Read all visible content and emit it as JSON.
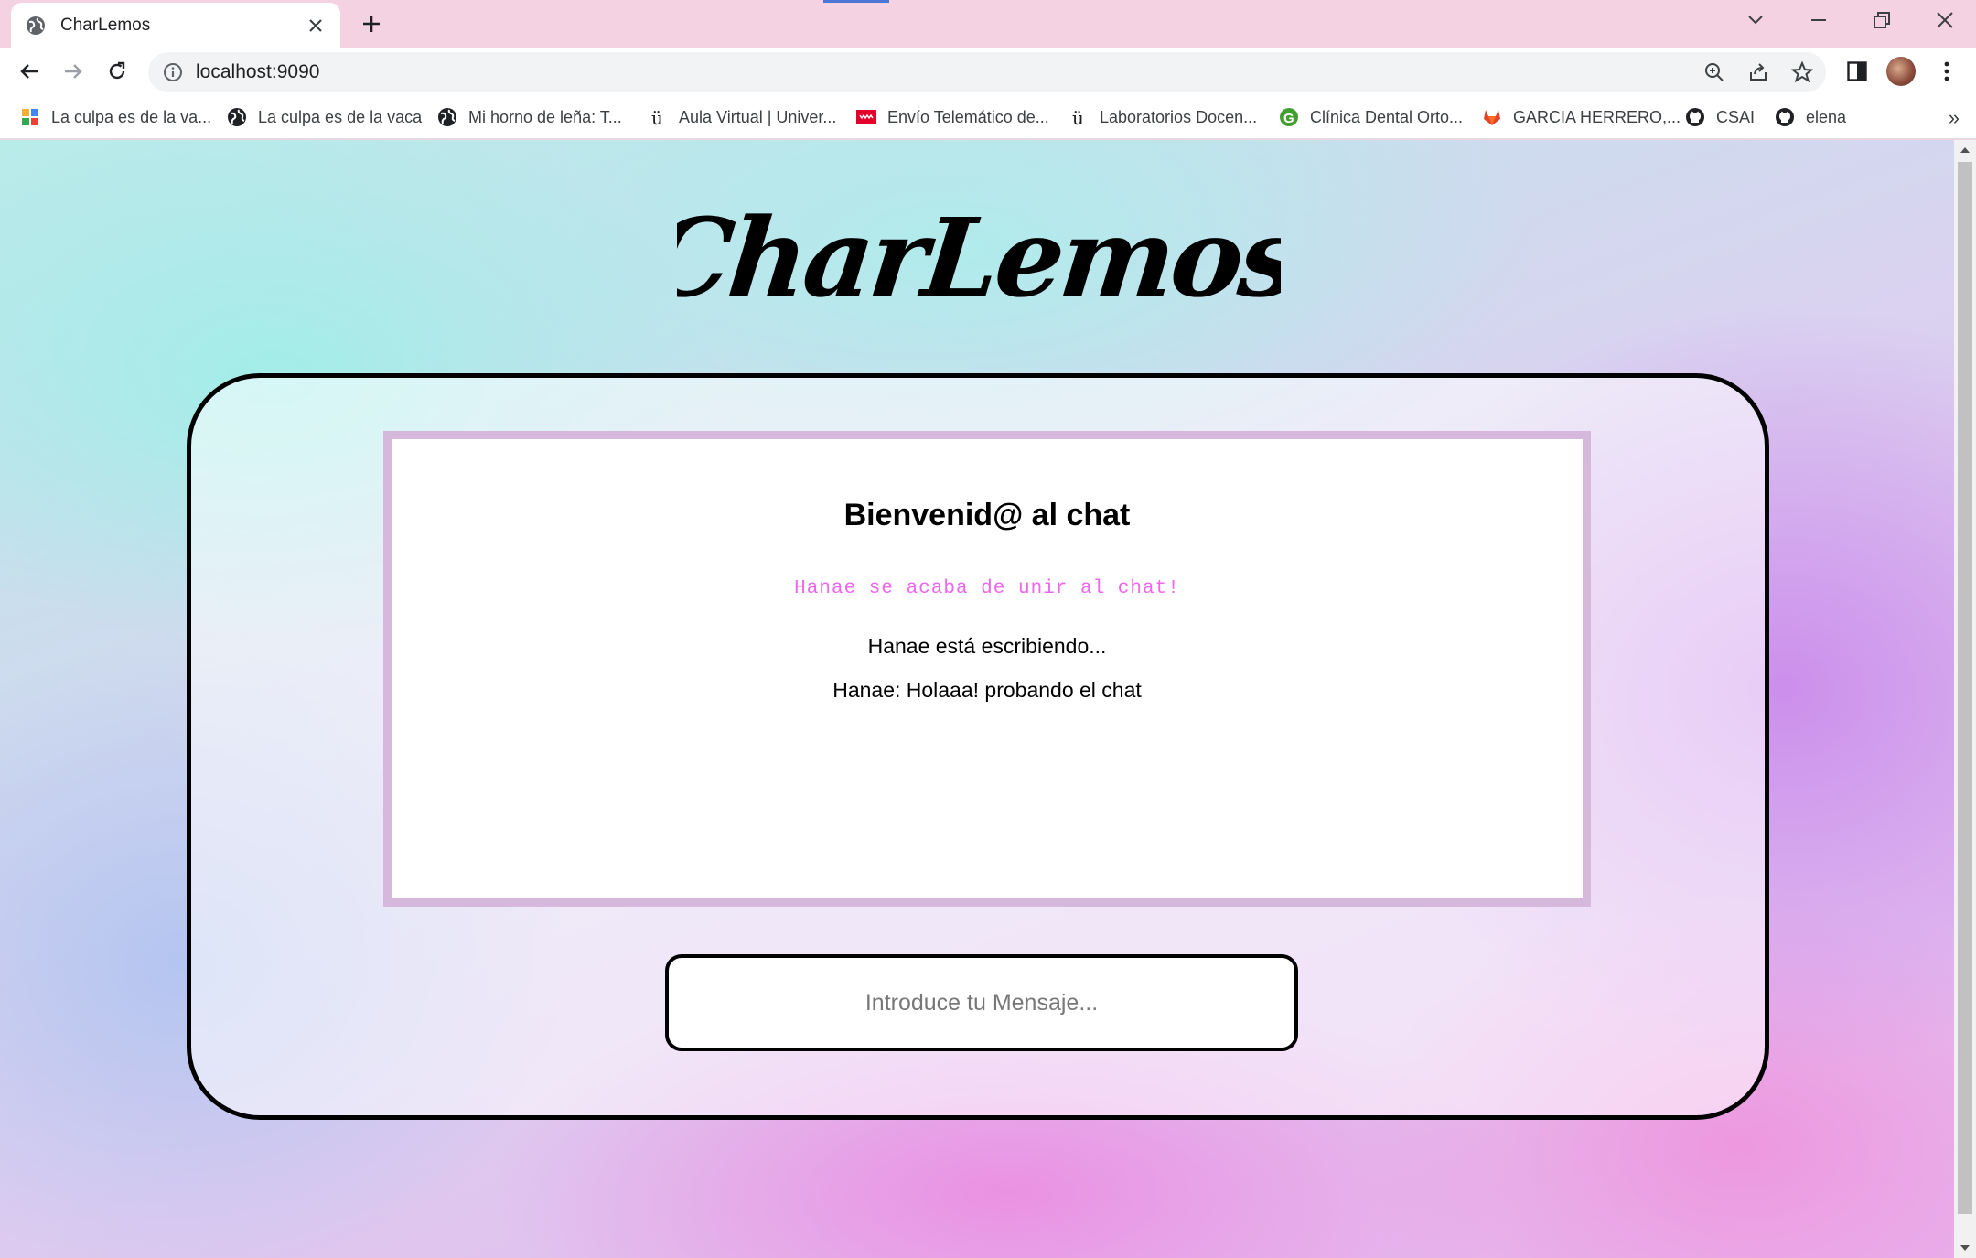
{
  "browser": {
    "tab": {
      "title": "CharLemos"
    },
    "address_bar": {
      "url": "localhost:9090"
    },
    "bookmarks": [
      {
        "label": "La culpa es de la va...",
        "icon": "collage-icon"
      },
      {
        "label": "La culpa es de la vaca",
        "icon": "globe-icon"
      },
      {
        "label": "Mi horno de leña: T...",
        "icon": "globe-icon"
      },
      {
        "label": "Aula Virtual | Univer...",
        "icon": "urjc-icon"
      },
      {
        "label": "Envío Telemático de...",
        "icon": "comunidad-madrid-icon"
      },
      {
        "label": "Laboratorios Docen...",
        "icon": "urjc-icon"
      },
      {
        "label": "Clínica Dental Orto...",
        "icon": "g-icon"
      },
      {
        "label": "GARCIA HERRERO,...",
        "icon": "gitlab-icon"
      },
      {
        "label": "CSAI",
        "icon": "github-icon"
      },
      {
        "label": "elena",
        "icon": "github-icon"
      }
    ],
    "more_bookmarks": "»"
  },
  "page": {
    "logo_text": "CharLemos",
    "chat": {
      "title": "Bienvenid@ al chat",
      "join_notice": "Hanae se acaba de unir al chat!",
      "typing_notice": "Hanae está escribiendo...",
      "messages": [
        {
          "text": "Hanae: Holaaa! probando el chat"
        }
      ]
    },
    "input": {
      "placeholder": "Introduce tu Mensaje..."
    }
  },
  "colors": {
    "join_notice": "#ee66ee",
    "messages_border": "#d7b8dd",
    "titlebar": "#f5d2e2"
  }
}
